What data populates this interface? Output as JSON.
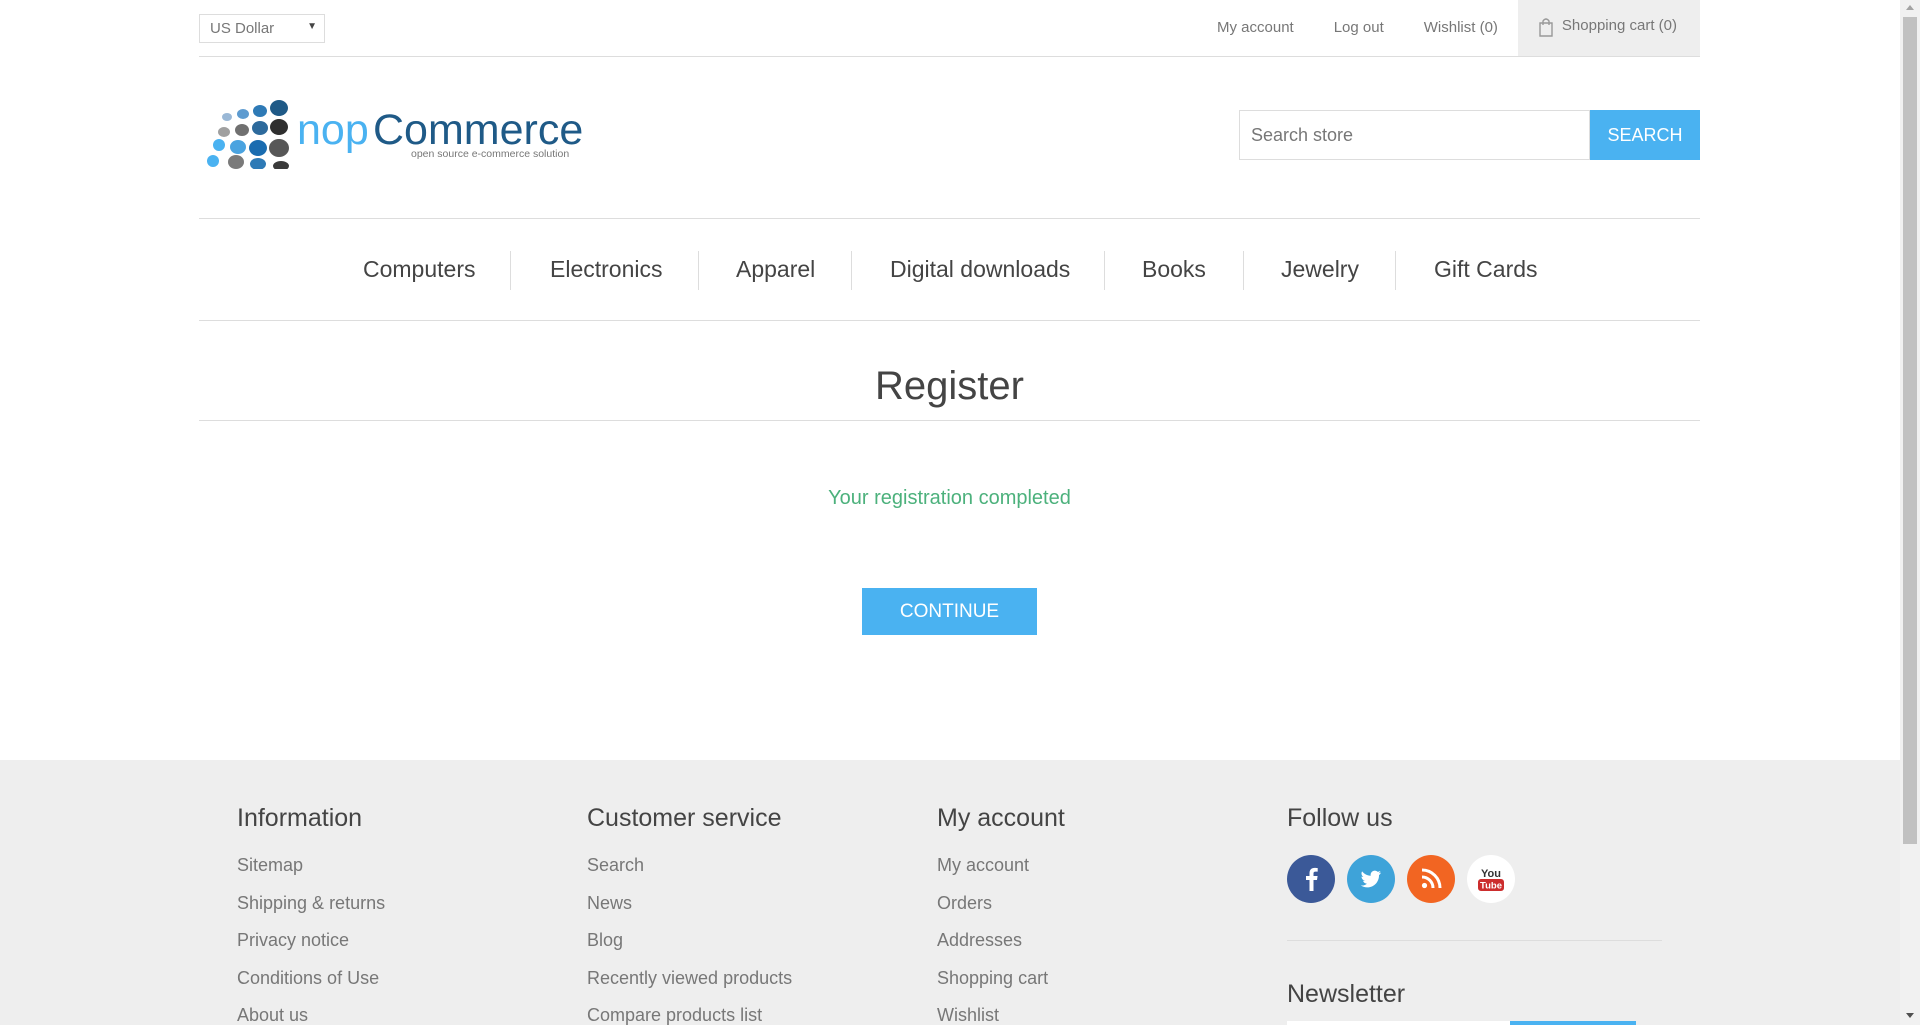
{
  "header": {
    "currency_selected": "US Dollar",
    "links": {
      "my_account": "My account",
      "log_out": "Log out",
      "wishlist": "Wishlist (0)",
      "shopping_cart": "Shopping cart (0)"
    }
  },
  "logo": {
    "brand_nop": "nop",
    "brand_commerce": "Commerce",
    "tagline": "open source e-commerce solution"
  },
  "search": {
    "placeholder": "Search store",
    "button_label": "Search"
  },
  "menu": {
    "items": [
      "Computers",
      "Electronics",
      "Apparel",
      "Digital downloads",
      "Books",
      "Jewelry",
      "Gift Cards"
    ]
  },
  "main": {
    "title": "Register",
    "result": "Your registration completed",
    "continue_label": "Continue"
  },
  "footer": {
    "information": {
      "title": "Information",
      "items": [
        "Sitemap",
        "Shipping & returns",
        "Privacy notice",
        "Conditions of Use",
        "About us"
      ]
    },
    "customer_service": {
      "title": "Customer service",
      "items": [
        "Search",
        "News",
        "Blog",
        "Recently viewed products",
        "Compare products list"
      ]
    },
    "my_account": {
      "title": "My account",
      "items": [
        "My account",
        "Orders",
        "Addresses",
        "Shopping cart",
        "Wishlist"
      ]
    },
    "follow_us": {
      "title": "Follow us",
      "social": [
        "facebook-icon",
        "twitter-icon",
        "rss-icon",
        "youtube-icon"
      ],
      "youtube_you": "You",
      "youtube_tube": "Tube"
    },
    "newsletter": {
      "title": "Newsletter"
    }
  },
  "colors": {
    "accent": "#4ab2f1",
    "success": "#4cb17c",
    "footer_bg": "#eeeeee"
  }
}
